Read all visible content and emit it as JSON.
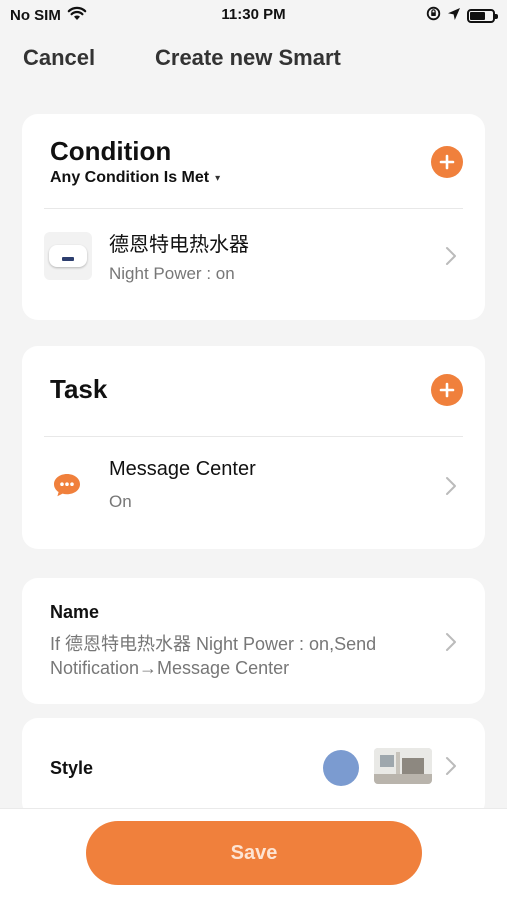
{
  "status_bar": {
    "carrier": "No SIM",
    "time": "11:30 PM",
    "battery_level": 0.7
  },
  "nav": {
    "cancel_label": "Cancel",
    "title": "Create new Smart"
  },
  "condition": {
    "title": "Condition",
    "mode": "Any Condition Is Met",
    "items": [
      {
        "name": "德恩特电热水器",
        "detail": "Night Power : on",
        "icon": "water-heater-icon"
      }
    ]
  },
  "task": {
    "title": "Task",
    "items": [
      {
        "name": "Message Center",
        "detail": "On",
        "icon": "message-icon"
      }
    ]
  },
  "name_section": {
    "label": "Name",
    "value": "If 德恩特电热水器 Night Power : on,Send Notification→Message Center"
  },
  "style_section": {
    "label": "Style",
    "color": "#7b9bd0"
  },
  "save_label": "Save",
  "colors": {
    "accent": "#f0803c",
    "background": "#f4f4f4"
  }
}
